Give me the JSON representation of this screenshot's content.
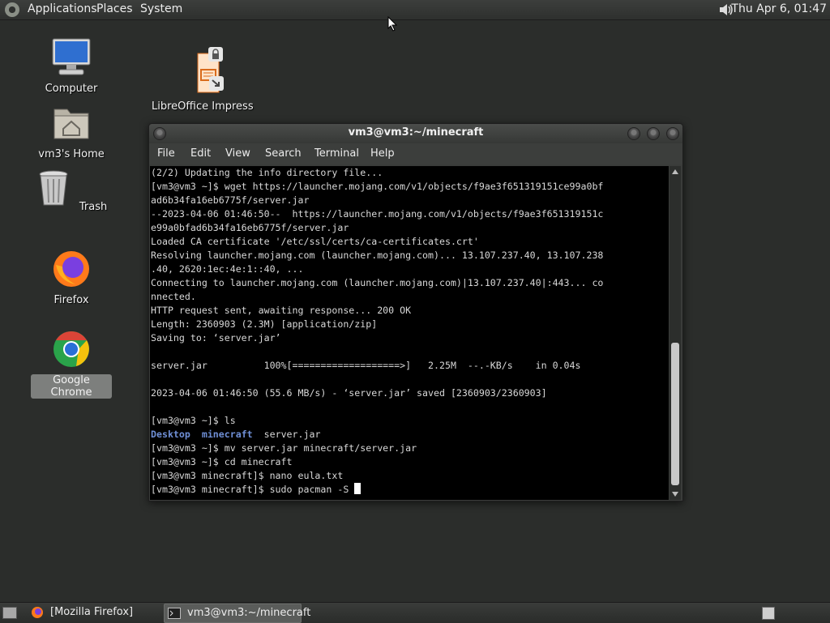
{
  "top_panel": {
    "menus": [
      "Applications",
      "Places",
      "System"
    ],
    "clock": "Thu Apr  6, 01:47"
  },
  "desktop": {
    "icons": [
      {
        "label": "Computer"
      },
      {
        "label": "vm3's Home"
      },
      {
        "label": "Trash"
      },
      {
        "label": "Firefox"
      },
      {
        "label": "Google Chrome"
      },
      {
        "label": "LibreOffice Impress"
      }
    ]
  },
  "terminal": {
    "title": "vm3@vm3:~/minecraft",
    "menus": [
      "File",
      "Edit",
      "View",
      "Search",
      "Terminal",
      "Help"
    ],
    "lines": [
      "(2/2) Updating the info directory file...",
      "[vm3@vm3 ~]$ wget https://launcher.mojang.com/v1/objects/f9ae3f651319151ce99a0bf",
      "ad6b34fa16eb6775f/server.jar",
      "--2023-04-06 01:46:50--  https://launcher.mojang.com/v1/objects/f9ae3f651319151c",
      "e99a0bfad6b34fa16eb6775f/server.jar",
      "Loaded CA certificate '/etc/ssl/certs/ca-certificates.crt'",
      "Resolving launcher.mojang.com (launcher.mojang.com)... 13.107.237.40, 13.107.238",
      ".40, 2620:1ec:4e:1::40, ...",
      "Connecting to launcher.mojang.com (launcher.mojang.com)|13.107.237.40|:443... co",
      "nnected.",
      "HTTP request sent, awaiting response... 200 OK",
      "Length: 2360903 (2.3M) [application/zip]",
      "Saving to: ‘server.jar’",
      "",
      "server.jar          100%[===================>]   2.25M  --.-KB/s    in 0.04s",
      "",
      "2023-04-06 01:46:50 (55.6 MB/s) - ‘server.jar’ saved [2360903/2360903]",
      "",
      "[vm3@vm3 ~]$ ls"
    ],
    "ls_output": {
      "dir1": "Desktop",
      "dir2": "minecraft",
      "file": "server.jar"
    },
    "lines_after": [
      "[vm3@vm3 ~]$ mv server.jar minecraft/server.jar",
      "[vm3@vm3 ~]$ cd minecraft",
      "[vm3@vm3 minecraft]$ nano eula.txt"
    ],
    "current_prompt": "[vm3@vm3 minecraft]$ sudo pacman -S "
  },
  "taskbar": {
    "tasks": [
      {
        "label": "[Mozilla Firefox]"
      },
      {
        "label": "vm3@vm3:~/minecraft"
      }
    ]
  }
}
